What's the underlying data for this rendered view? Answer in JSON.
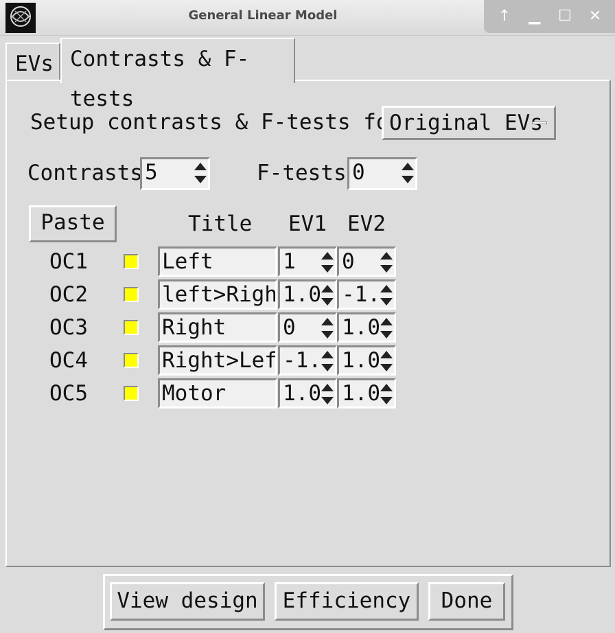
{
  "window": {
    "title": "General Linear Model",
    "controls": [
      "↑",
      "▁",
      "☐",
      "✕"
    ]
  },
  "tabs": [
    {
      "label": "EVs",
      "active": false
    },
    {
      "label": "Contrasts & F-tests",
      "active": true
    }
  ],
  "setup": {
    "label": "Setup contrasts & F-tests for",
    "dropdown_value": "Original EVs"
  },
  "counts": {
    "contrasts_label": "Contrasts",
    "contrasts_value": "5",
    "ftests_label": "F-tests",
    "ftests_value": "0"
  },
  "table": {
    "paste_label": "Paste",
    "headers": {
      "title": "Title",
      "ev1": "EV1",
      "ev2": "EV2"
    },
    "rows": [
      {
        "name": "OC1",
        "title": "Left",
        "ev1": "1",
        "ev2": "0"
      },
      {
        "name": "OC2",
        "title": "left>Right",
        "ev1": "1.0",
        "ev2": "-1."
      },
      {
        "name": "OC3",
        "title": "Right",
        "ev1": "0",
        "ev2": "1.0"
      },
      {
        "name": "OC4",
        "title": "Right>Left",
        "ev1": "-1.",
        "ev2": "1.0"
      },
      {
        "name": "OC5",
        "title": "Motor",
        "ev1": "1.0",
        "ev2": "1.0"
      }
    ]
  },
  "buttons": {
    "view_design": "View design",
    "efficiency": "Efficiency",
    "done": "Done"
  },
  "colors": {
    "swatch": "#ffff00",
    "background": "#dcdcdc"
  }
}
